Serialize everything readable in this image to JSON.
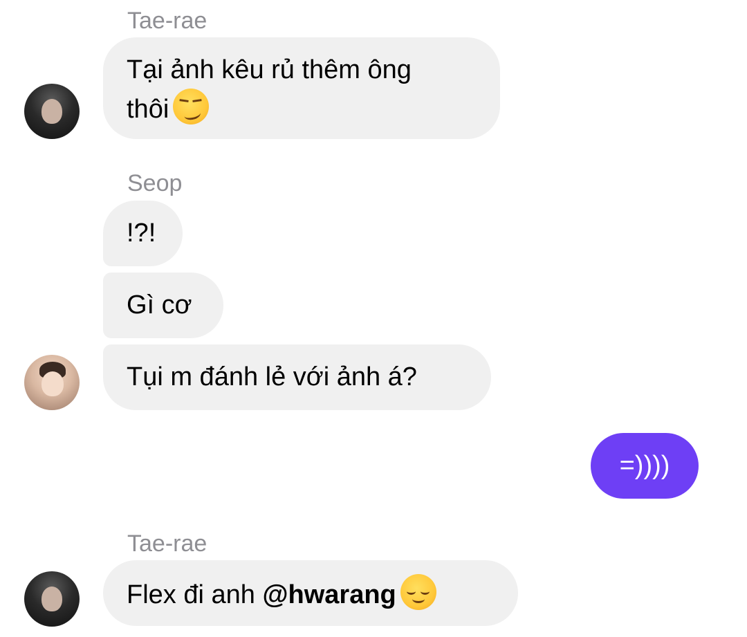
{
  "conversation": {
    "groups": [
      {
        "sender": "Tae-rae",
        "messages": [
          {
            "text": "Tại ảnh kêu rủ thêm ông",
            "text2": "thôi",
            "emoji": "smirking-face-emoji"
          }
        ]
      },
      {
        "sender": "Seop",
        "messages": [
          {
            "text": "!?!"
          },
          {
            "text": "Gì cơ"
          },
          {
            "text": "Tụi m đánh lẻ với ảnh á?"
          }
        ]
      },
      {
        "sender": "me",
        "messages": [
          {
            "text": "=))))"
          }
        ]
      },
      {
        "sender": "Tae-rae",
        "messages": [
          {
            "text": "Flex đi anh ",
            "mention": "@hwarang",
            "emoji": "relieved-face-emoji"
          }
        ]
      }
    ]
  },
  "colors": {
    "incoming_bubble": "#f0f0f0",
    "outgoing_bubble": "#6e3ff5",
    "sender_name": "#8e8e93"
  }
}
